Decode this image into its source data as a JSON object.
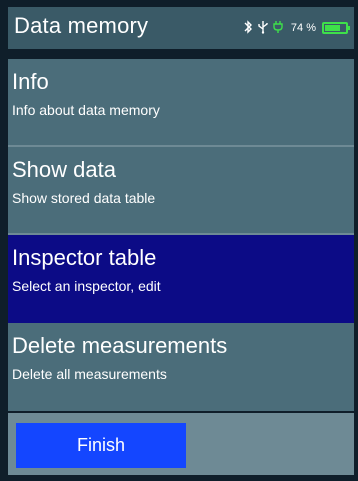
{
  "header": {
    "title": "Data memory",
    "status": {
      "bluetooth_icon": "bluetooth-icon",
      "usb_icon": "usb-icon",
      "plug_icon": "power-plug-icon",
      "battery_percent_label": "74 %",
      "battery_level": 0.74,
      "battery_color": "#3ee04a"
    }
  },
  "menu": {
    "items": [
      {
        "title": "Info",
        "subtitle": "Info about data memory",
        "selected": false
      },
      {
        "title": "Show data",
        "subtitle": "Show stored data table",
        "selected": false
      },
      {
        "title": "Inspector table",
        "subtitle": "Select an inspector, edit",
        "selected": true
      },
      {
        "title": "Delete measurements",
        "subtitle": "Delete all measurements",
        "selected": false
      }
    ]
  },
  "footer": {
    "finish_label": "Finish"
  },
  "colors": {
    "header_bg": "#3a5a67",
    "menu_bg": "#4b6d7a",
    "selected_bg": "#0c0b86",
    "button_bg": "#1446ff",
    "footer_bg": "#6e8a95"
  }
}
